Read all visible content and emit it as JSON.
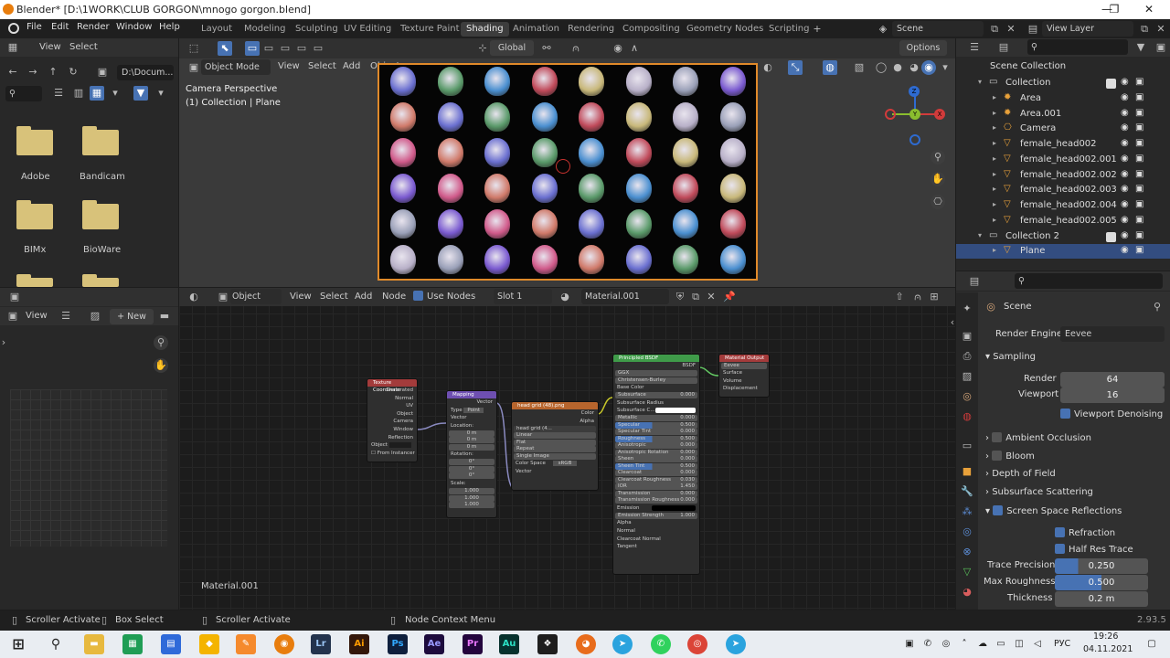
{
  "window": {
    "title": "Blender* [D:\\1WORK\\CLUB GORGON\\mnogo gorgon.blend]"
  },
  "menu": [
    "File",
    "Edit",
    "Render",
    "Window",
    "Help"
  ],
  "workspaces": [
    "Layout",
    "Modeling",
    "Sculpting",
    "UV Editing",
    "Texture Paint",
    "Shading",
    "Animation",
    "Rendering",
    "Compositing",
    "Geometry Nodes",
    "Scripting"
  ],
  "active_workspace": "Shading",
  "scene_field": "Scene",
  "view_layer_field": "View Layer",
  "file_browser": {
    "menu": [
      "View",
      "Select"
    ],
    "path": "D:\\Docum...",
    "folders": [
      "Adobe",
      "Bandicam",
      "BIMx",
      "BioWare"
    ]
  },
  "image_editor": {
    "view": "View",
    "new": "New"
  },
  "viewport": {
    "mode": "Object Mode",
    "menu": [
      "View",
      "Select",
      "Add",
      "Object"
    ],
    "transform": "Global",
    "options": "Options",
    "overlay_line1": "Camera Perspective",
    "overlay_line2": "(1) Collection | Plane"
  },
  "node_editor": {
    "type": "Object",
    "menu": [
      "View",
      "Select",
      "Add",
      "Node"
    ],
    "use_nodes": "Use Nodes",
    "slot": "Slot 1",
    "material": "Material.001",
    "footer_label": "Material.001"
  },
  "nodes": {
    "tex_coord": {
      "title": "Texture Coordinate",
      "outputs": [
        "Generated",
        "Normal",
        "UV",
        "Object",
        "Camera",
        "Window",
        "Reflection"
      ],
      "object_label": "Object",
      "from_instancer": "From Instancer"
    },
    "mapping": {
      "title": "Mapping",
      "out": "Vector",
      "type_label": "Type",
      "type_value": "Point",
      "vector": "Vector",
      "location": "Location:",
      "rotation": "Rotation:",
      "scale": "Scale:",
      "loc": [
        "0 m",
        "0 m",
        "0 m"
      ],
      "rot": [
        "0°",
        "0°",
        "0°"
      ],
      "scl": [
        "1.000",
        "1.000",
        "1.000"
      ]
    },
    "image": {
      "title": "head grid (48).png",
      "out": [
        "Color",
        "Alpha"
      ],
      "file": "head grid (4...",
      "opts": [
        "Linear",
        "Flat",
        "Repeat",
        "Single Image"
      ],
      "color_space_label": "Color Space",
      "color_space": "sRGB",
      "in": "Vector"
    },
    "bsdf": {
      "title": "Principled BSDF",
      "out": "BSDF",
      "opts": [
        "GGX",
        "Christensen-Burley"
      ],
      "rows": [
        [
          "Base Color",
          ""
        ],
        [
          "Subsurface",
          "0.000"
        ],
        [
          "Subsurface Radius",
          ""
        ],
        [
          "Subsurface C...",
          ""
        ],
        [
          "Metallic",
          "0.000"
        ],
        [
          "Specular",
          "0.500"
        ],
        [
          "Specular Tint",
          "0.000"
        ],
        [
          "Roughness",
          "0.500"
        ],
        [
          "Anisotropic",
          "0.000"
        ],
        [
          "Anisotropic Rotation",
          "0.000"
        ],
        [
          "Sheen",
          "0.000"
        ],
        [
          "Sheen Tint",
          "0.500"
        ],
        [
          "Clearcoat",
          "0.000"
        ],
        [
          "Clearcoat Roughness",
          "0.030"
        ],
        [
          "IOR",
          "1.450"
        ],
        [
          "Transmission",
          "0.000"
        ],
        [
          "Transmission Roughness",
          "0.000"
        ],
        [
          "Emission",
          ""
        ],
        [
          "Emission Strength",
          "1.000"
        ],
        [
          "Alpha",
          ""
        ],
        [
          "Normal",
          ""
        ],
        [
          "Clearcoat Normal",
          ""
        ],
        [
          "Tangent",
          ""
        ]
      ]
    },
    "output": {
      "title": "Material Output",
      "target": "Eevee",
      "inputs": [
        "Surface",
        "Volume",
        "Displacement"
      ]
    }
  },
  "outliner": {
    "root": "Scene Collection",
    "items": [
      {
        "name": "Collection",
        "level": 1,
        "kind": "collection"
      },
      {
        "name": "Area",
        "level": 2,
        "kind": "light"
      },
      {
        "name": "Area.001",
        "level": 2,
        "kind": "light"
      },
      {
        "name": "Camera",
        "level": 2,
        "kind": "camera"
      },
      {
        "name": "female_head002",
        "level": 2,
        "kind": "mesh"
      },
      {
        "name": "female_head002.001",
        "level": 2,
        "kind": "mesh"
      },
      {
        "name": "female_head002.002",
        "level": 2,
        "kind": "mesh"
      },
      {
        "name": "female_head002.003",
        "level": 2,
        "kind": "mesh"
      },
      {
        "name": "female_head002.004",
        "level": 2,
        "kind": "mesh"
      },
      {
        "name": "female_head002.005",
        "level": 2,
        "kind": "mesh"
      },
      {
        "name": "Collection 2",
        "level": 1,
        "kind": "collection"
      },
      {
        "name": "Plane",
        "level": 2,
        "kind": "mesh"
      }
    ]
  },
  "properties": {
    "context": "Scene",
    "render_engine_label": "Render Engine",
    "render_engine": "Eevee",
    "sampling": "Sampling",
    "render_label": "Render",
    "render_value": "64",
    "viewport_label": "Viewport",
    "viewport_value": "16",
    "viewport_denoising": "Viewport Denoising",
    "panels": [
      "Ambient Occlusion",
      "Bloom",
      "Depth of Field",
      "Subsurface Scattering",
      "Screen Space Reflections"
    ],
    "refraction": "Refraction",
    "half_res_trace": "Half Res Trace",
    "trace_precision_label": "Trace Precision",
    "trace_precision": "0.250",
    "max_roughness_label": "Max Roughness",
    "max_roughness": "0.500",
    "thickness_label": "Thickness",
    "thickness": "0.2 m"
  },
  "statusbar": {
    "left1": "Scroller Activate",
    "left2": "Box Select",
    "mid": "Scroller Activate",
    "right": "Node Context Menu",
    "version": "2.93.5"
  },
  "taskbar": {
    "lang": "РУС",
    "time": "19:26",
    "date": "04.11.2021"
  },
  "colors": {
    "accent": "#4772b3",
    "active_tab": "#3d3d3d",
    "selection": "#334d80"
  }
}
